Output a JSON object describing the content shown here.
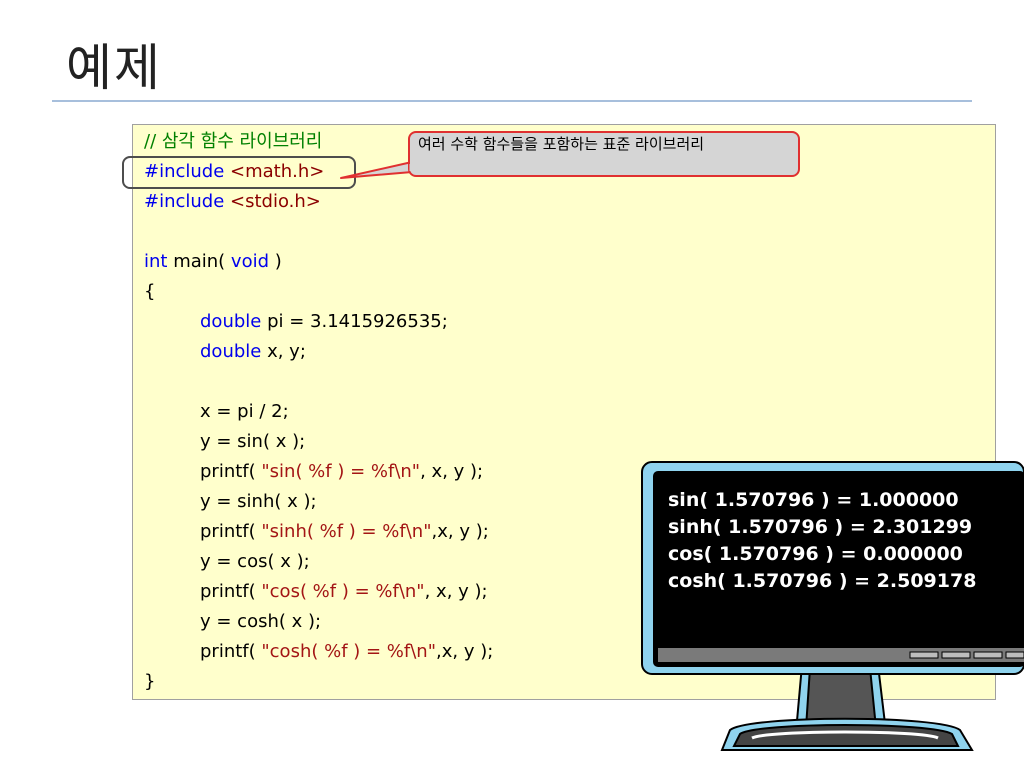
{
  "slide": {
    "title": "예제"
  },
  "code": {
    "comment": "// 삼각 함수 라이브러리",
    "include_math_directive": "#include",
    "include_math_header": "<math.h>",
    "include_stdio_directive": "#include",
    "include_stdio_header": "<stdio.h>",
    "main_kw_int": "int",
    "main_name": " main( ",
    "main_kw_void": "void",
    "main_close": " )",
    "open_brace": "{",
    "decl1_kw": "double",
    "decl1_rest": " pi = 3.1415926535;",
    "decl2_kw": "double",
    "decl2_rest": " x, y;",
    "stmt_x": "x = pi / 2;",
    "stmt_sin": "y = sin( x );",
    "printf_sin_pre": "printf( ",
    "printf_sin_str": "\"sin( %f ) = %f\\n\"",
    "printf_sin_post": ", x, y );",
    "stmt_sinh": "y = sinh( x );",
    "printf_sinh_pre": "printf( ",
    "printf_sinh_str": "\"sinh( %f ) = %f\\n\"",
    "printf_sinh_post": ",x, y );",
    "stmt_cos": "y = cos( x );",
    "printf_cos_pre": "printf( ",
    "printf_cos_str": "\"cos( %f ) = %f\\n\"",
    "printf_cos_post": ", x, y );",
    "stmt_cosh": "y = cosh( x );",
    "printf_cosh_pre": "printf( ",
    "printf_cosh_str": "\"cosh( %f ) = %f\\n\"",
    "printf_cosh_post": ",x, y );",
    "close_brace": "}"
  },
  "callout": {
    "text": "여러 수학 함수들을 포함하는 표준 라이브러리"
  },
  "output": {
    "lines": [
      "sin( 1.570796 ) = 1.000000",
      "sinh( 1.570796 ) = 2.301299",
      "cos( 1.570796 ) = 0.000000",
      "cosh( 1.570796 ) = 2.509178"
    ]
  },
  "colors": {
    "code_background": "#ffffcc",
    "keyword": "#0000ee",
    "string": "#a31515",
    "comment": "#008000",
    "callout_border": "#e03030",
    "callout_fill": "#d5d5d5",
    "monitor_frame": "#8fd3ee",
    "screen": "#000000"
  }
}
